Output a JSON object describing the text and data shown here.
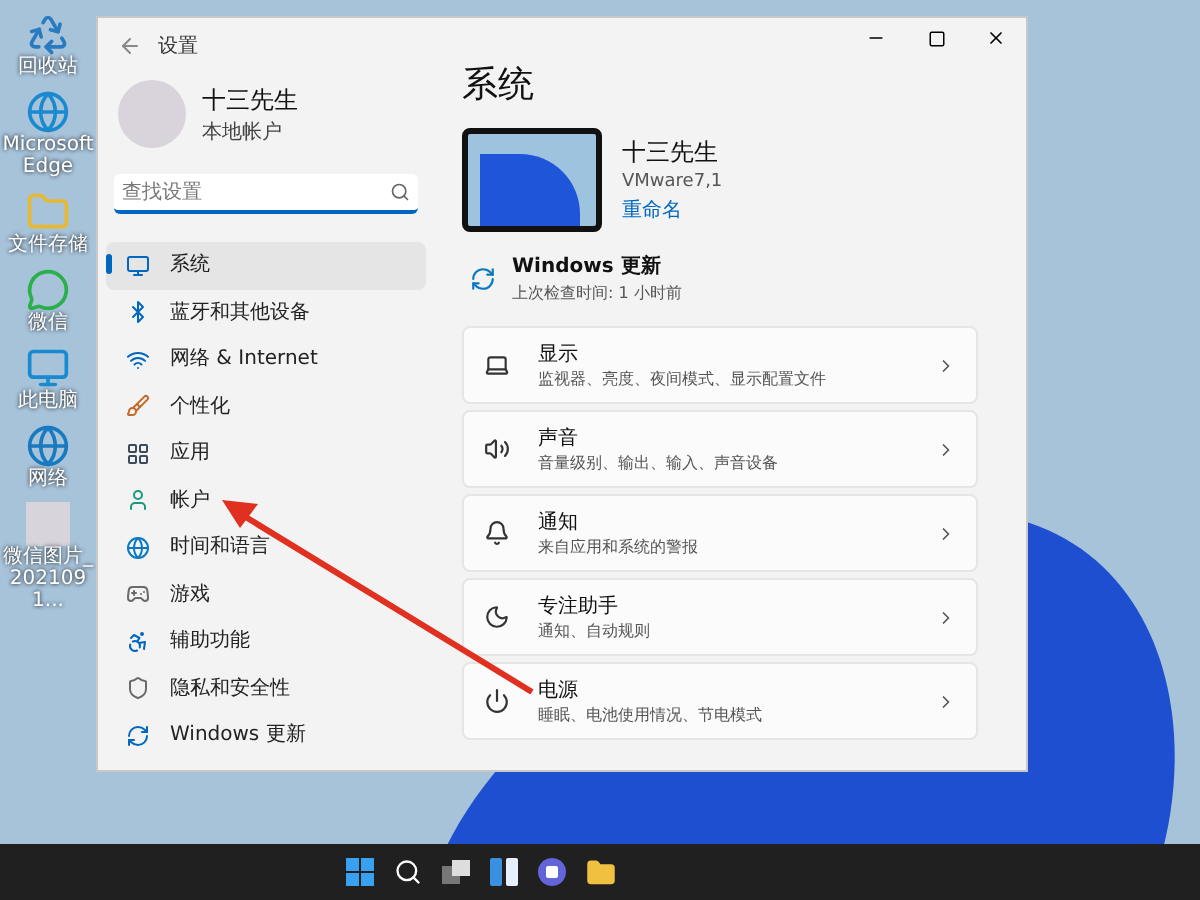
{
  "desktop_icons": [
    {
      "label": "回收站"
    },
    {
      "label": "Microsoft Edge"
    },
    {
      "label": "文件存储"
    },
    {
      "label": "微信"
    },
    {
      "label": "此电脑"
    },
    {
      "label": "网络"
    },
    {
      "label": "微信图片_2021091..."
    }
  ],
  "window": {
    "title": "设置"
  },
  "profile": {
    "name": "十三先生",
    "account_type": "本地帐户"
  },
  "search": {
    "placeholder": "查找设置"
  },
  "sidebar": {
    "items": [
      {
        "label": "系统",
        "selected": true
      },
      {
        "label": "蓝牙和其他设备",
        "selected": false
      },
      {
        "label": "网络 & Internet",
        "selected": false
      },
      {
        "label": "个性化",
        "selected": false
      },
      {
        "label": "应用",
        "selected": false
      },
      {
        "label": "帐户",
        "selected": false
      },
      {
        "label": "时间和语言",
        "selected": false
      },
      {
        "label": "游戏",
        "selected": false
      },
      {
        "label": "辅助功能",
        "selected": false
      },
      {
        "label": "隐私和安全性",
        "selected": false
      },
      {
        "label": "Windows 更新",
        "selected": false
      }
    ]
  },
  "content": {
    "title": "系统",
    "device": {
      "name": "十三先生",
      "model": "VMware7,1",
      "rename_link": "重命名"
    },
    "update": {
      "title": "Windows 更新",
      "subtitle": "上次检查时间: 1 小时前"
    },
    "cards": [
      {
        "title": "显示",
        "subtitle": "监视器、亮度、夜间模式、显示配置文件"
      },
      {
        "title": "声音",
        "subtitle": "音量级别、输出、输入、声音设备"
      },
      {
        "title": "通知",
        "subtitle": "来自应用和系统的警报"
      },
      {
        "title": "专注助手",
        "subtitle": "通知、自动规则"
      },
      {
        "title": "电源",
        "subtitle": "睡眠、电池使用情况、节电模式"
      }
    ]
  }
}
